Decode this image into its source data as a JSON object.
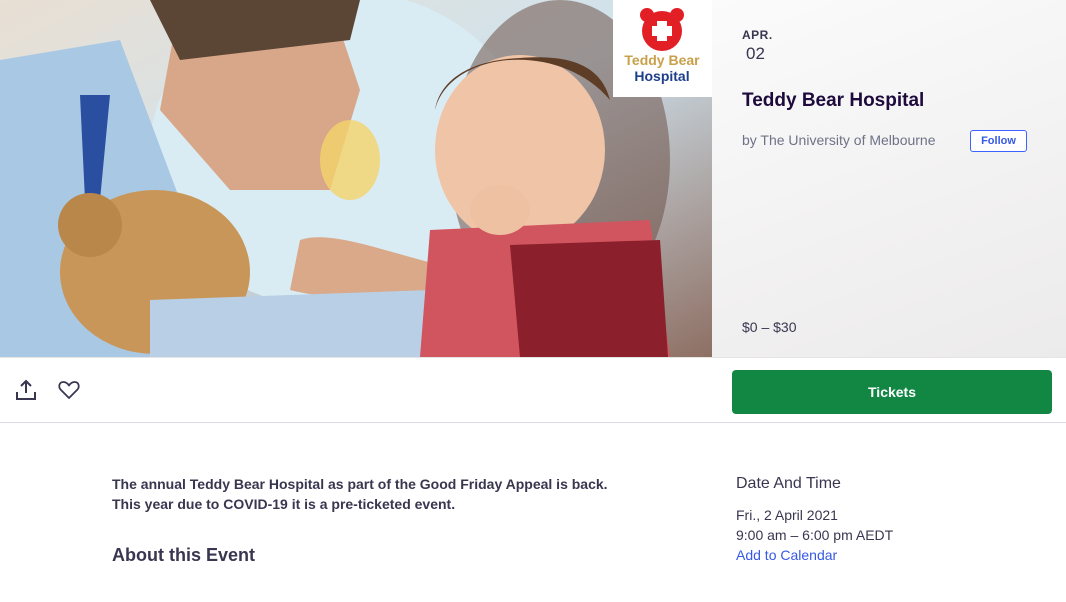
{
  "event": {
    "month": "APR.",
    "day": "02",
    "title": "Teddy Bear Hospital",
    "organizer": "by The University of Melbourne",
    "follow_label": "Follow",
    "price": "$0 – $30",
    "logo_text_line1": "Teddy Bear",
    "logo_text_line2": "Hospital"
  },
  "actions": {
    "share_icon": "share-icon",
    "like_icon": "heart-icon",
    "tickets_label": "Tickets"
  },
  "body": {
    "description": "The annual Teddy Bear Hospital as part of the Good Friday Appeal is back. This year due to COVID-19 it is a pre-ticketed event.",
    "about_heading": "About this Event"
  },
  "date_time": {
    "heading": "Date And Time",
    "date": "Fri., 2 April 2021",
    "time": "9:00 am – 6:00 pm AEDT",
    "add_to_calendar": "Add to Calendar"
  },
  "colors": {
    "tickets_green": "#128744",
    "link_blue": "#3659e3",
    "logo_red": "#e31f26",
    "logo_gold": "#c8a04a",
    "logo_blue": "#1d3f8a"
  }
}
